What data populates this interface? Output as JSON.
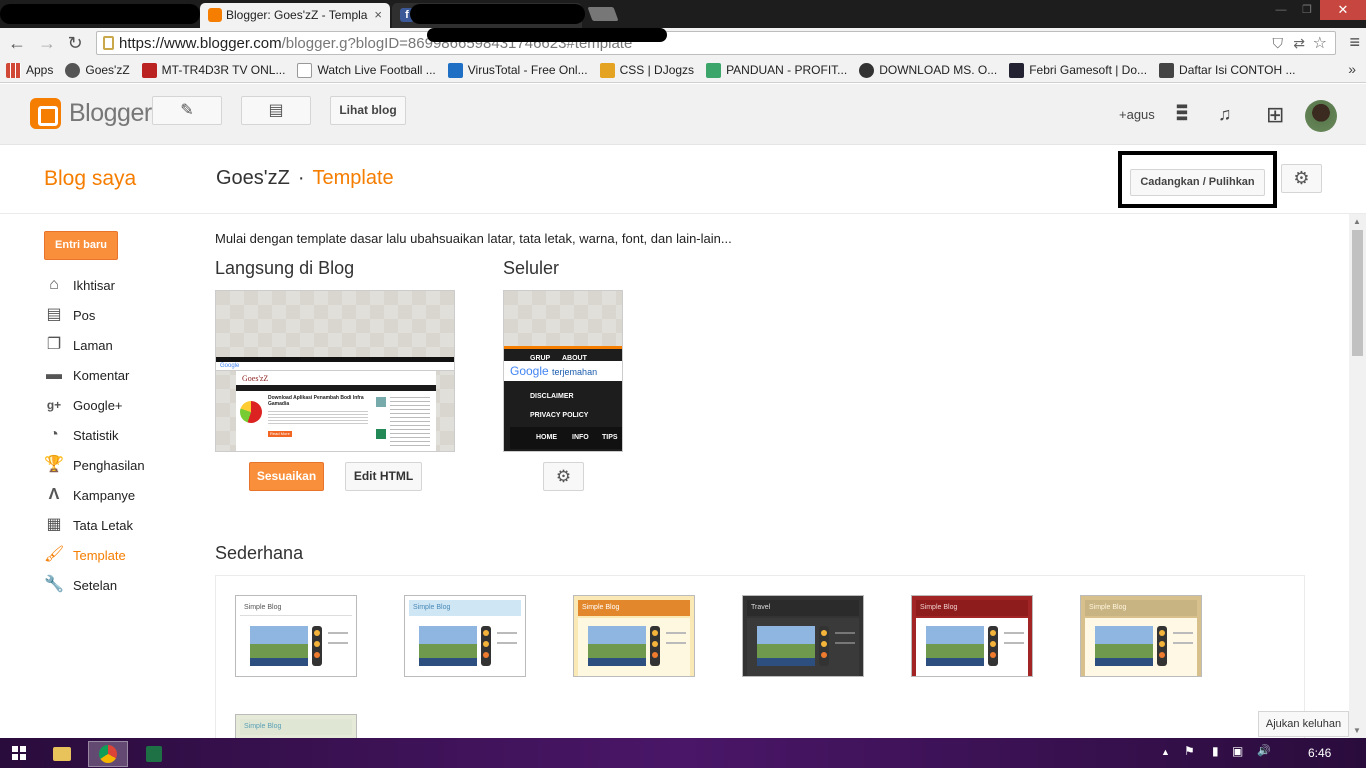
{
  "browser": {
    "tabs": [
      {
        "title": "Blogger: Goes'zZ - Templa",
        "close": "×",
        "fav_color": "#f57d00"
      },
      {
        "title": "",
        "fav_color": "#3b5998",
        "fav_letter": "f"
      }
    ],
    "window_controls": {
      "minimize": "—",
      "maximize": "❐",
      "close": "✕"
    },
    "nav": {
      "back": "←",
      "forward": "→",
      "reload": "↻"
    },
    "url_scheme_host": "https://www.blogger.com",
    "url_rest": "/blogger.g?blogID=869986659843174662​3#template",
    "bookmarks": [
      {
        "label": "Apps",
        "color": "#d14836"
      },
      {
        "label": "Goes'zZ",
        "color": "#555"
      },
      {
        "label": "MT-TR4D3R TV ONL...",
        "color": "#b22"
      },
      {
        "label": "Watch Live Football ...",
        "color": "#ddd"
      },
      {
        "label": "VirusTotal - Free Onl...",
        "color": "#1f6fc5"
      },
      {
        "label": "CSS | DJogzs",
        "color": "#e5a323"
      },
      {
        "label": "PANDUAN - PROFIT...",
        "color": "#3ca66a"
      },
      {
        "label": "DOWNLOAD MS. O...",
        "color": "#333"
      },
      {
        "label": "Febri Gamesoft | Do...",
        "color": "#223"
      },
      {
        "label": "Daftar Isi CONTOH ...",
        "color": "#444"
      }
    ],
    "bookmarks_more": "»"
  },
  "header": {
    "logo_text": "Blogger",
    "edit_icon": "✎",
    "posts_icon": "▤",
    "view_blog": "Lihat blog",
    "user": "+agus",
    "apps_icon": "⋮⋮⋮",
    "bell_icon": "🔔",
    "add_icon": "⊞"
  },
  "title": {
    "my_blogs": "Blog saya",
    "blog_name": "Goes'zZ",
    "separator": "·",
    "section": "Template",
    "backup": "Cadangkan / Pulihkan",
    "settings_icon": "⚙"
  },
  "sidebar": {
    "new_post": "Entri baru",
    "items": [
      {
        "label": "Ikhtisar",
        "icon": "⌂"
      },
      {
        "label": "Pos",
        "icon": "▤"
      },
      {
        "label": "Laman",
        "icon": "❐"
      },
      {
        "label": "Komentar",
        "icon": "▬"
      },
      {
        "label": "Google+",
        "icon": "g+"
      },
      {
        "label": "Statistik",
        "icon": "◔"
      },
      {
        "label": "Penghasilan",
        "icon": "🏆"
      },
      {
        "label": "Kampanye",
        "icon": "Λ"
      },
      {
        "label": "Tata Letak",
        "icon": "▦"
      },
      {
        "label": "Template",
        "icon": "🖌"
      },
      {
        "label": "Setelan",
        "icon": "🔧"
      }
    ]
  },
  "main": {
    "intro": "Mulai dengan template dasar lalu ubahsuaikan latar, tata letak, warna, font, dan lain-lain...",
    "live_heading": "Langsung di Blog",
    "mobile_heading": "Seluler",
    "customize": "Sesuaikan",
    "edit_html": "Edit HTML",
    "simple_heading": "Sederhana",
    "live_preview": {
      "blog_title": "Goes'zZ",
      "post_title": "Download Aplikasi Penambah Bodi Infra Gamadia",
      "search_brand": "Google",
      "read_more": "Read More"
    },
    "mobile_preview": {
      "tabs": [
        "GRUP",
        "ABOUT"
      ],
      "search_brand": "Google",
      "search_text": "terjemahan",
      "links": [
        "DISCLAIMER",
        "PRIVACY POLICY"
      ],
      "nav": [
        "HOME",
        "INFO",
        "TIPS"
      ]
    },
    "simple_themes": [
      {
        "label": "Simple Blog",
        "bar": "#ffffff",
        "bar_text": "#555",
        "bg": "#ffffff"
      },
      {
        "label": "Simple Blog",
        "bar": "#cfe6f4",
        "bar_text": "#4a8ab8",
        "bg": "#ffffff"
      },
      {
        "label": "Simple Blog",
        "bar": "#e2872c",
        "bar_text": "#ffffff",
        "bg": "#fbe9b5"
      },
      {
        "label": "Travel",
        "bar": "#2b2b2b",
        "bar_text": "#dddddd",
        "bg": "#333333"
      },
      {
        "label": "Simple Blog",
        "bar": "#8e1c1c",
        "bar_text": "#f1d0d0",
        "bg": "#a32424"
      },
      {
        "label": "Simple Blog",
        "bar": "#c8b382",
        "bar_text": "#fff6dd",
        "bg": "#fff8e5"
      },
      {
        "label": "Simple Blog",
        "bar": "#dfe6d4",
        "bar_text": "#5aa0b5",
        "bg": "#eef0e4"
      }
    ]
  },
  "feedback": "Ajukan keluhan",
  "taskbar": {
    "clock": "6:46",
    "tray_up": "▲",
    "tray_flag": "⚑",
    "tray_battery": "▮",
    "tray_network": "▣",
    "tray_volume": "🔊"
  }
}
